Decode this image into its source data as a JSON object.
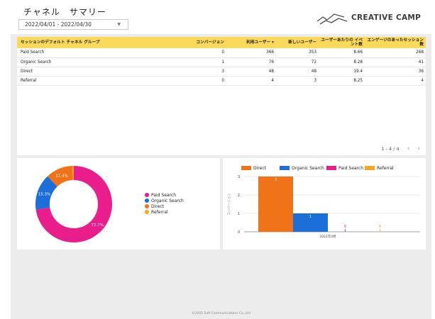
{
  "header": {
    "title": "チャネル　サマリー",
    "date_range": "2022/04/01 - 2022/04/30",
    "logo_text": "CREATIVE CAMP"
  },
  "table": {
    "columns": [
      "セッションのデフォルト チャネル グループ",
      "コンバージョン",
      "利用ユーザー ▾",
      "新しいユーザー",
      "ユーザーあたりの イベント数",
      "エンゲージのあったセッション数"
    ],
    "rows": [
      [
        "Paid Search",
        "0",
        "366",
        "353",
        "8.66",
        "268"
      ],
      [
        "Organic Search",
        "1",
        "76",
        "72",
        "8.28",
        "41"
      ],
      [
        "Direct",
        "3",
        "48",
        "48",
        "19.4",
        "36"
      ],
      [
        "Referral",
        "0",
        "4",
        "3",
        "8.25",
        "4"
      ]
    ],
    "pagination": "1 - 4 / 4",
    "prev_icon": "chevron-left-icon",
    "next_icon": "chevron-right-icon"
  },
  "colors": {
    "paid_search": "#e91e8c",
    "organic_search": "#1c6fd8",
    "direct": "#f07318",
    "referral": "#f5a623",
    "header_yellow": "#fbd95a"
  },
  "chart_data": [
    {
      "type": "pie",
      "donut": true,
      "labels": [
        "Paid Search",
        "Organic Search",
        "Direct",
        "Referral"
      ],
      "values": [
        72.7,
        15.3,
        11.4,
        0.6
      ],
      "value_labels": [
        "72.7%",
        "15.3%",
        "11.4%",
        ""
      ],
      "colors": [
        "#e91e8c",
        "#1c6fd8",
        "#f07318",
        "#f5a623"
      ],
      "legend": "right"
    },
    {
      "type": "bar",
      "categories": [
        "2022年4月"
      ],
      "series": [
        {
          "name": "Direct",
          "values": [
            3
          ],
          "color": "#f07318"
        },
        {
          "name": "Organic Search",
          "values": [
            1
          ],
          "color": "#1c6fd8"
        },
        {
          "name": "Paid Search",
          "values": [
            0
          ],
          "color": "#e91e8c"
        },
        {
          "name": "Referral",
          "values": [
            0
          ],
          "color": "#f5a623"
        }
      ],
      "ylabel": "コンバージョン",
      "yticks": [
        0,
        1,
        2,
        3
      ],
      "ylim": [
        0,
        3
      ],
      "legend": "top"
    }
  ],
  "footer": "©2005 Soft Communications Co.,Ltd"
}
